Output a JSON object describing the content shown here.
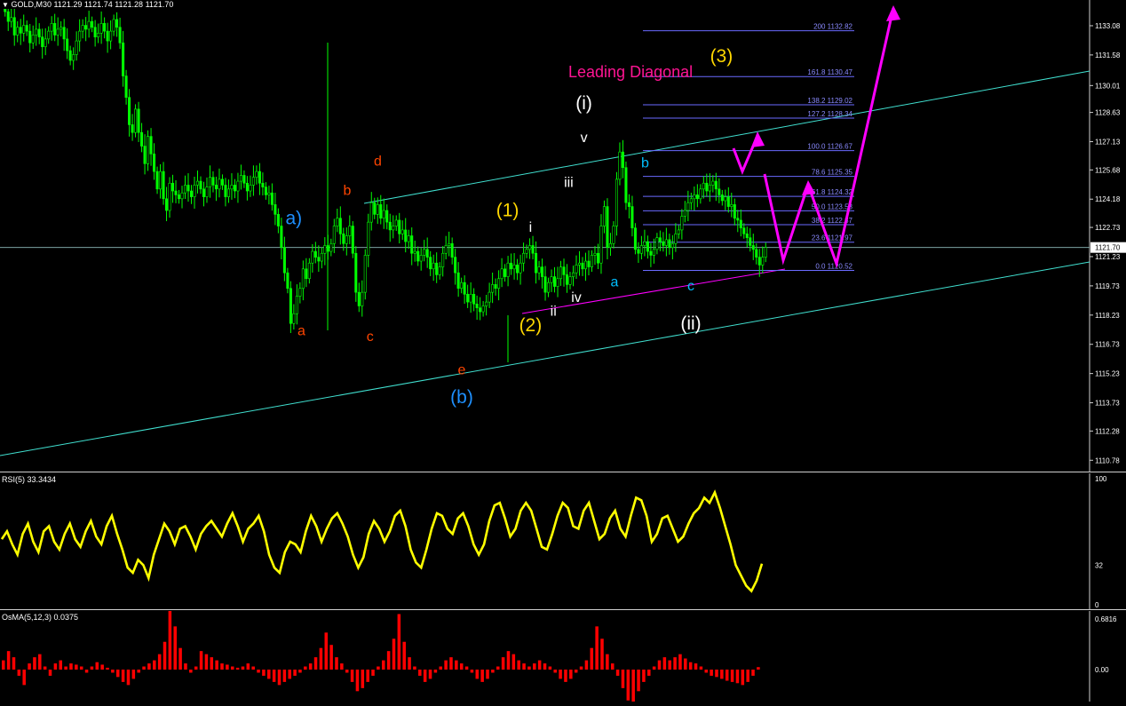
{
  "header": {
    "symbol_info": "GOLD,M30",
    "quote": "1121.29 1121.74 1121.28 1121.70",
    "rsi_title": "RSI(5) 33.3434",
    "osma_title": "OsMA(5,12,3) 0.0375"
  },
  "chart_data": [
    {
      "type": "candlestick",
      "series_name": "GOLD,M30",
      "ylim": [
        1110.2,
        1134.4
      ],
      "price_ticks": [
        "1133.08",
        "1131.58",
        "1130.01",
        "1128.63",
        "1127.13",
        "1125.68",
        "1124.18",
        "1122.73",
        "1121.23",
        "1119.73",
        "1118.23",
        "1116.73",
        "1115.23",
        "1113.73",
        "1112.28",
        "1110.78"
      ],
      "current_price": "1121.70",
      "path_points": [
        1133.8,
        1133.3,
        1133.5,
        1132.6,
        1133.0,
        1132.7,
        1133.1,
        1132.8,
        1132.2,
        1132.6,
        1132.9,
        1132.5,
        1132.0,
        1132.4,
        1132.8,
        1133.2,
        1132.6,
        1132.9,
        1133.0,
        1132.4,
        1131.8,
        1131.3,
        1131.6,
        1132.3,
        1132.8,
        1133.1,
        1132.9,
        1133.3,
        1133.0,
        1132.5,
        1132.7,
        1133.2,
        1132.8,
        1132.3,
        1132.8,
        1133.4,
        1133.0,
        1132.2,
        1130.5,
        1129.4,
        1128.0,
        1127.6,
        1128.8,
        1127.6,
        1126.9,
        1126.0,
        1127.4,
        1126.5,
        1125.6,
        1124.7,
        1125.6,
        1124.2,
        1123.6,
        1125.0,
        1124.6,
        1124.4,
        1124.2,
        1124.5,
        1124.9,
        1124.6,
        1124.3,
        1124.9,
        1125.1,
        1124.7,
        1124.3,
        1124.8,
        1125.3,
        1124.9,
        1124.7,
        1125.2,
        1124.9,
        1124.3,
        1124.7,
        1124.9,
        1124.6,
        1125.1,
        1125.4,
        1125.0,
        1124.6,
        1124.9,
        1125.3,
        1125.6,
        1125.0,
        1124.8,
        1124.4,
        1124.5,
        1123.9,
        1123.4,
        1122.8,
        1121.7,
        1120.4,
        1119.6,
        1117.8,
        1118.3,
        1119.2,
        1119.6,
        1120.6,
        1120.1,
        1120.9,
        1121.5,
        1121.2,
        1121.0,
        1121.4,
        1121.8,
        1121.5,
        1121.9,
        1122.8,
        1123.2,
        1122.4,
        1121.9,
        1122.3,
        1122.8,
        1121.4,
        1119.4,
        1118.7,
        1119.4,
        1121.3,
        1123.0,
        1124.0,
        1123.4,
        1123.9,
        1123.2,
        1123.6,
        1123.0,
        1122.6,
        1122.8,
        1123.1,
        1122.4,
        1122.6,
        1122.0,
        1122.3,
        1121.4,
        1121.5,
        1121.0,
        1121.3,
        1121.6,
        1121.2,
        1120.6,
        1120.9,
        1120.3,
        1120.7,
        1121.4,
        1121.8,
        1121.9,
        1121.2,
        1120.4,
        1119.6,
        1119.9,
        1119.3,
        1118.9,
        1119.3,
        1118.8,
        1118.6,
        1118.4,
        1118.7,
        1118.9,
        1119.4,
        1119.8,
        1119.6,
        1120.1,
        1120.6,
        1120.2,
        1120.9,
        1120.6,
        1120.8,
        1120.4,
        1120.9,
        1121.4,
        1121.6,
        1121.8,
        1121.4,
        1120.4,
        1120.7,
        1120.2,
        1119.4,
        1119.9,
        1120.2,
        1119.7,
        1120.1,
        1120.7,
        1120.3,
        1119.8,
        1120.2,
        1120.4,
        1120.8,
        1120.9,
        1120.6,
        1121.0,
        1120.7,
        1121.3,
        1121.4,
        1120.9,
        1122.8,
        1123.8,
        1121.7,
        1121.9,
        1122.8,
        1125.2,
        1126.6,
        1125.8,
        1124.0,
        1123.8,
        1122.7,
        1121.6,
        1121.4,
        1121.8,
        1122.0,
        1121.5,
        1121.3,
        1121.6,
        1122.2,
        1122.0,
        1121.8,
        1122.1,
        1121.7,
        1121.9,
        1122.4,
        1122.6,
        1123.3,
        1123.6,
        1124.0,
        1124.2,
        1124.4,
        1124.2,
        1124.7,
        1125.0,
        1124.6,
        1124.9,
        1125.1,
        1124.7,
        1124.4,
        1124.1,
        1124.3,
        1123.8,
        1123.9,
        1123.2,
        1123.1,
        1122.7,
        1122.4,
        1122.2,
        1121.8,
        1121.6,
        1121.2,
        1120.8,
        1121.2,
        1121.7
      ]
    },
    {
      "type": "line",
      "series_name": "RSI(5)",
      "value": 33.3434,
      "ylim": [
        0,
        100
      ],
      "ticks": [
        "100",
        "32",
        "0"
      ],
      "values": [
        52,
        58,
        48,
        40,
        56,
        64,
        50,
        42,
        58,
        62,
        50,
        44,
        56,
        64,
        52,
        46,
        58,
        66,
        54,
        48,
        62,
        70,
        56,
        44,
        30,
        26,
        36,
        32,
        22,
        40,
        52,
        64,
        58,
        48,
        60,
        62,
        54,
        44,
        56,
        62,
        66,
        60,
        54,
        64,
        72,
        62,
        50,
        60,
        64,
        70,
        58,
        40,
        30,
        26,
        42,
        50,
        48,
        42,
        58,
        70,
        62,
        50,
        60,
        68,
        72,
        64,
        54,
        40,
        30,
        38,
        56,
        66,
        60,
        50,
        58,
        70,
        74,
        62,
        44,
        34,
        30,
        44,
        60,
        72,
        70,
        60,
        56,
        68,
        72,
        62,
        48,
        40,
        48,
        66,
        78,
        80,
        68,
        54,
        60,
        74,
        80,
        74,
        60,
        46,
        44,
        56,
        70,
        80,
        76,
        62,
        60,
        74,
        80,
        66,
        52,
        56,
        68,
        74,
        60,
        54,
        70,
        84,
        82,
        70,
        50,
        56,
        68,
        70,
        60,
        50,
        54,
        64,
        72,
        76,
        84,
        80,
        88,
        76,
        62,
        48,
        32,
        24,
        16,
        12,
        20,
        33
      ]
    },
    {
      "type": "bar",
      "series_name": "OsMA(5,12,3)",
      "value": 0.0375,
      "ticks": [
        "0.6816",
        "0.00"
      ],
      "values": [
        0.15,
        0.3,
        0.2,
        -0.1,
        -0.25,
        0.1,
        0.2,
        0.25,
        0.05,
        -0.1,
        0.1,
        0.15,
        0.05,
        0.1,
        0.08,
        0.05,
        -0.05,
        0.05,
        0.12,
        0.08,
        0.03,
        -0.05,
        -0.12,
        -0.2,
        -0.25,
        -0.15,
        -0.05,
        0.05,
        0.1,
        0.15,
        0.25,
        0.45,
        0.95,
        0.7,
        0.35,
        0.1,
        -0.05,
        0.05,
        0.3,
        0.25,
        0.2,
        0.15,
        0.1,
        0.08,
        0.05,
        0.03,
        0.05,
        0.1,
        0.05,
        -0.05,
        -0.1,
        -0.15,
        -0.2,
        -0.25,
        -0.2,
        -0.15,
        -0.1,
        -0.05,
        0.05,
        0.1,
        0.2,
        0.35,
        0.6,
        0.4,
        0.2,
        0.1,
        -0.05,
        -0.2,
        -0.35,
        -0.3,
        -0.2,
        -0.1,
        0.05,
        0.15,
        0.3,
        0.5,
        0.9,
        0.45,
        0.2,
        0.05,
        -0.1,
        -0.2,
        -0.15,
        -0.05,
        0.05,
        0.15,
        0.2,
        0.15,
        0.1,
        0.05,
        -0.05,
        -0.15,
        -0.2,
        -0.15,
        -0.05,
        0.05,
        0.2,
        0.3,
        0.25,
        0.15,
        0.1,
        0.05,
        0.1,
        0.15,
        0.1,
        0.05,
        -0.05,
        -0.15,
        -0.2,
        -0.15,
        -0.05,
        0.05,
        0.15,
        0.35,
        0.7,
        0.5,
        0.25,
        0.1,
        -0.1,
        -0.3,
        -0.5,
        -0.6,
        -0.35,
        -0.2,
        -0.1,
        0.05,
        0.15,
        0.2,
        0.15,
        0.2,
        0.25,
        0.18,
        0.12,
        0.1,
        0.05,
        -0.05,
        -0.1,
        -0.12,
        -0.15,
        -0.18,
        -0.2,
        -0.22,
        -0.25,
        -0.2,
        -0.1,
        0.04
      ]
    },
    {
      "type": "annotation",
      "title": "Leading Diagonal",
      "wave_labels": [
        {
          "text": "a)",
          "color": "#1e90ff",
          "price": 1122.9,
          "bar": 38
        },
        {
          "text": "a",
          "color": "#ff4500",
          "price": 1117.2,
          "bar": 39
        },
        {
          "text": "b",
          "color": "#ff4500",
          "price": 1124.4,
          "bar": 45
        },
        {
          "text": "c",
          "color": "#ff4500",
          "price": 1116.9,
          "bar": 48
        },
        {
          "text": "d",
          "color": "#ff4500",
          "price": 1125.9,
          "bar": 49
        },
        {
          "text": "e",
          "color": "#ff4500",
          "price": 1115.2,
          "bar": 60
        },
        {
          "text": "(b)",
          "color": "#1e90ff",
          "price": 1113.7,
          "bar": 60
        },
        {
          "text": "(1)",
          "color": "#ffd700",
          "price": 1123.3,
          "bar": 66
        },
        {
          "text": "i",
          "color": "#ffffff",
          "price": 1122.5,
          "bar": 69
        },
        {
          "text": "(2)",
          "color": "#ffd700",
          "price": 1117.4,
          "bar": 69
        },
        {
          "text": "ii",
          "color": "#ffffff",
          "price": 1118.2,
          "bar": 72
        },
        {
          "text": "iii",
          "color": "#ffffff",
          "price": 1124.8,
          "bar": 74
        },
        {
          "text": "iv",
          "color": "#ffffff",
          "price": 1118.9,
          "bar": 75
        },
        {
          "text": "v",
          "color": "#ffffff",
          "price": 1127.1,
          "bar": 76
        },
        {
          "text": "(i)",
          "color": "#ffffff",
          "price": 1128.8,
          "bar": 76
        },
        {
          "text": "a",
          "color": "#00bfff",
          "price": 1119.7,
          "bar": 80
        },
        {
          "text": "b",
          "color": "#00bfff",
          "price": 1125.8,
          "bar": 84
        },
        {
          "text": "c",
          "color": "#00bfff",
          "price": 1119.5,
          "bar": 90
        },
        {
          "text": "(ii)",
          "color": "#ffffff",
          "price": 1117.5,
          "bar": 90
        },
        {
          "text": "(3)",
          "color": "#ffd700",
          "price": 1131.2,
          "bar": 94
        }
      ],
      "fibonacci": [
        {
          "level": "200",
          "price": "1132.82"
        },
        {
          "level": "161.8",
          "price": "1130.47"
        },
        {
          "level": "138.2",
          "price": "1129.02"
        },
        {
          "level": "127.2",
          "price": "1128.34"
        },
        {
          "level": "100.0",
          "price": "1126.67"
        },
        {
          "level": "78.6",
          "price": "1125.35"
        },
        {
          "level": "61.8",
          "price": "1124.32"
        },
        {
          "level": "50.0",
          "price": "1123.58"
        },
        {
          "level": "38.2",
          "price": "1122.87"
        },
        {
          "level": "23.6",
          "price": "1121.97"
        },
        {
          "level": "0.0",
          "price": "1120.52"
        }
      ],
      "colors": {
        "bull_candle": "#00ff00",
        "channel": "#40e0d0",
        "projection": "#ff00ff",
        "fib": "#6a6aff",
        "rsi": "#ffff00",
        "osma": "#ff0000"
      }
    }
  ]
}
